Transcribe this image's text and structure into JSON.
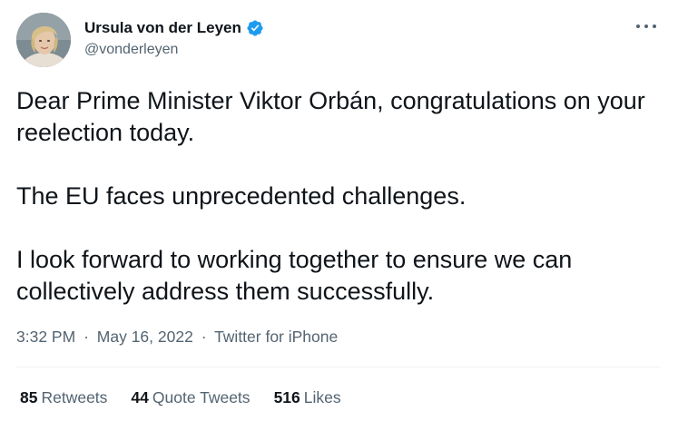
{
  "author": {
    "display_name": "Ursula von der Leyen",
    "handle": "@vonderleyen",
    "verified_icon": "verified-badge-icon",
    "verified_color": "#1d9bf0"
  },
  "tweet": {
    "paragraphs": [
      "Dear Prime Minister Viktor Orbán, congratulations on your reelection today.",
      "The EU faces unprecedented challenges.",
      "I look forward to working together to ensure we can collectively address them successfully."
    ]
  },
  "meta": {
    "time": "3:32 PM",
    "date": "May 16, 2022",
    "source": "Twitter for iPhone",
    "separator": "·"
  },
  "stats": {
    "retweets_count": "85",
    "retweets_label": "Retweets",
    "quote_tweets_count": "44",
    "quote_tweets_label": "Quote Tweets",
    "likes_count": "516",
    "likes_label": "Likes"
  },
  "icons": {
    "more": "more-options-icon",
    "avatar": "profile-avatar"
  }
}
